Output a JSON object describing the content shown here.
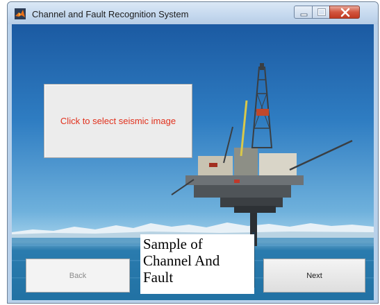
{
  "window": {
    "title": "Channel and Fault Recognition System",
    "icon": "matlab-icon",
    "controls": [
      "minimize-icon",
      "maximize-icon",
      "close-icon"
    ]
  },
  "main": {
    "select_button_label": "Click to select seismic image",
    "caption_lines": [
      "Sample of",
      "Channel And",
      "Fault"
    ],
    "back_label": "Back",
    "back_enabled": false,
    "next_label": "Next"
  },
  "colors": {
    "select_text": "#e1301c",
    "close_button": "#c03a22",
    "sky_top": "#1b5aa2",
    "sea": "#1a6a9a"
  }
}
